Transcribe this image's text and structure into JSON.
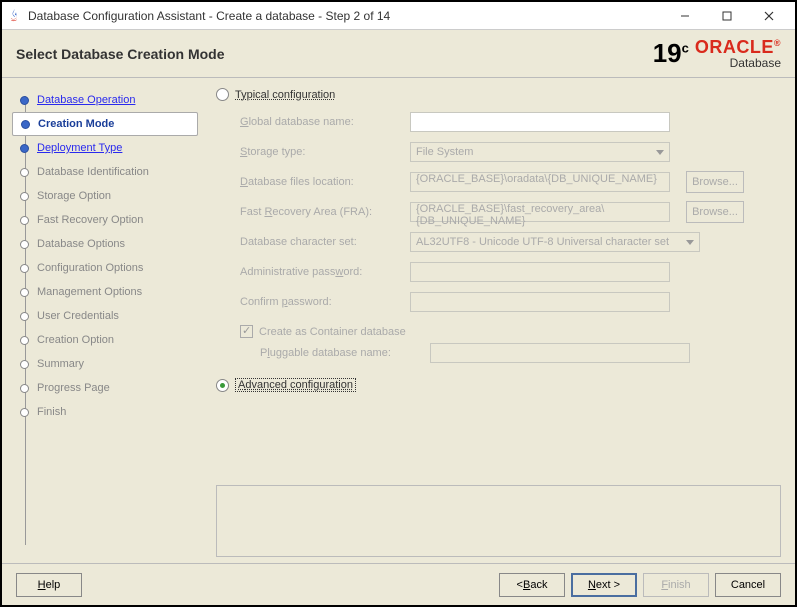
{
  "window": {
    "title": "Database Configuration Assistant - Create a database - Step 2 of 14"
  },
  "header": {
    "title": "Select Database Creation Mode",
    "logo_19c": "19",
    "logo_c": "c",
    "logo_oracle": "ORACLE",
    "logo_db": "Database"
  },
  "sidebar": {
    "items": [
      {
        "label": "Database Operation",
        "state": "done"
      },
      {
        "label": "Creation Mode",
        "state": "current"
      },
      {
        "label": "Deployment Type",
        "state": "visited-next"
      },
      {
        "label": "Database Identification",
        "state": "future"
      },
      {
        "label": "Storage Option",
        "state": "future"
      },
      {
        "label": "Fast Recovery Option",
        "state": "future"
      },
      {
        "label": "Database Options",
        "state": "future"
      },
      {
        "label": "Configuration Options",
        "state": "future"
      },
      {
        "label": "Management Options",
        "state": "future"
      },
      {
        "label": "User Credentials",
        "state": "future"
      },
      {
        "label": "Creation Option",
        "state": "future"
      },
      {
        "label": "Summary",
        "state": "future"
      },
      {
        "label": "Progress Page",
        "state": "future"
      },
      {
        "label": "Finish",
        "state": "future"
      }
    ]
  },
  "form": {
    "typical_label": "Typical configuration",
    "advanced_label": "Advanced configuration",
    "selected_mode": "advanced",
    "global_db_label": "Global database name:",
    "global_db_value": "",
    "storage_type_label": "Storage type:",
    "storage_type_value": "File System",
    "db_files_label": "Database files location:",
    "db_files_value": "{ORACLE_BASE}\\oradata\\{DB_UNIQUE_NAME}",
    "fra_label": "Fast Recovery Area (FRA):",
    "fra_value": "{ORACLE_BASE}\\fast_recovery_area\\{DB_UNIQUE_NAME}",
    "charset_label": "Database character set:",
    "charset_value": "AL32UTF8 - Unicode UTF-8 Universal character set",
    "admin_pw_label": "Administrative password:",
    "confirm_pw_label": "Confirm password:",
    "container_label": "Create as Container database",
    "container_checked": true,
    "pdb_label": "Pluggable database name:",
    "browse_label": "Browse..."
  },
  "footer": {
    "help": "Help",
    "back": "< Back",
    "next": "Next >",
    "finish": "Finish",
    "cancel": "Cancel"
  }
}
